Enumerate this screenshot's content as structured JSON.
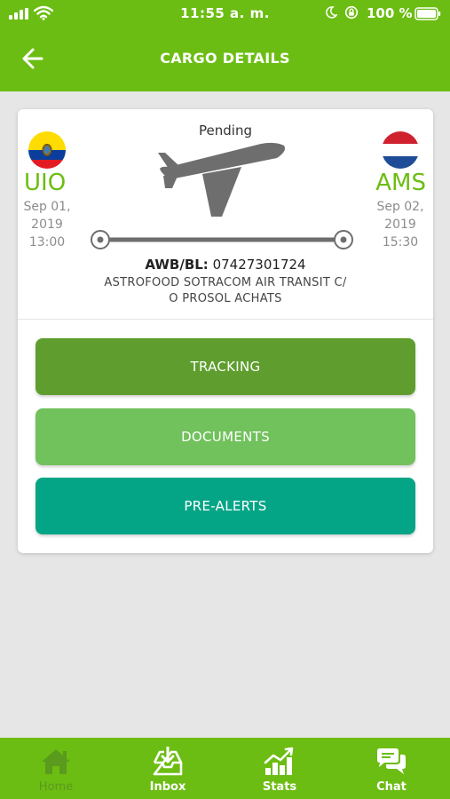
{
  "status_bar": {
    "time": "11:55 a. m.",
    "battery": "100 %"
  },
  "header": {
    "title": "CARGO DETAILS"
  },
  "shipment": {
    "status": "Pending",
    "origin": {
      "code": "UIO",
      "date_line1": "Sep 01,",
      "date_line2": "2019",
      "time": "13:00",
      "flag": "ecuador-flag"
    },
    "destination": {
      "code": "AMS",
      "date_line1": "Sep 02,",
      "date_line2": "2019",
      "time": "15:30",
      "flag": "netherlands-flag"
    },
    "awb_label": "AWB/BL:",
    "awb_number": "07427301724",
    "consignee_line1": "ASTROFOOD SOTRACOM AIR TRANSIT C/",
    "consignee_line2": "O PROSOL ACHATS"
  },
  "actions": {
    "tracking": "TRACKING",
    "documents": "DOCUMENTS",
    "prealerts": "PRE-ALERTS"
  },
  "tabs": [
    {
      "label": "Home",
      "icon": "home-icon"
    },
    {
      "label": "Inbox",
      "icon": "inbox-icon"
    },
    {
      "label": "Stats",
      "icon": "stats-icon"
    },
    {
      "label": "Chat",
      "icon": "chat-icon"
    }
  ],
  "colors": {
    "brand_green": "#6cbd13",
    "tracking": "#5f9e2e",
    "documents": "#71c15c",
    "prealerts": "#04a586",
    "active_tab": "#5a9a1c"
  }
}
